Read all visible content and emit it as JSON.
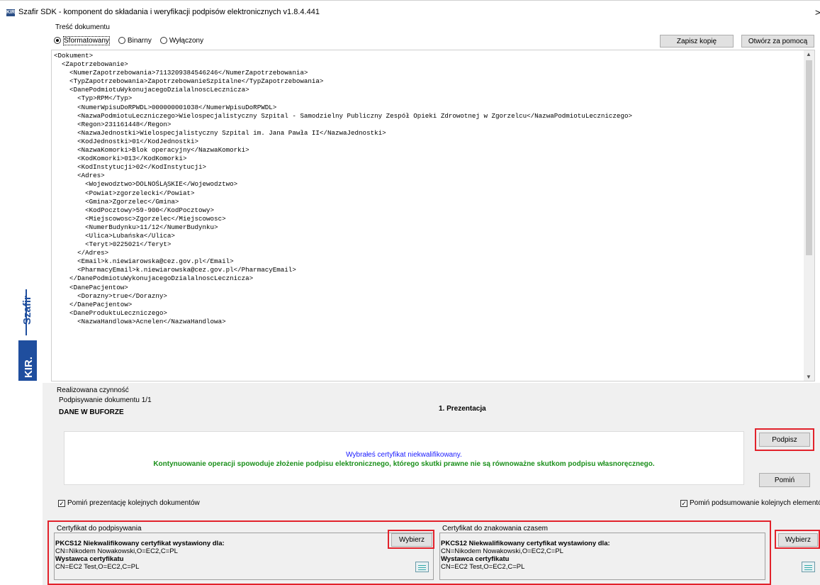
{
  "window": {
    "app_icon_text": "KIR",
    "title": "Szafir SDK - komponent do składania i weryfikacji podpisów elektronicznych v1.8.4.441",
    "close_glyph": ">"
  },
  "branding": {
    "szafir": "Szafir",
    "kir": "KIR."
  },
  "content_section": {
    "label": "Treść dokumentu",
    "radios": [
      {
        "label": "Sformatowany",
        "selected": true
      },
      {
        "label": "Binarny",
        "selected": false
      },
      {
        "label": "Wyłączony",
        "selected": false
      }
    ],
    "save_copy_button": "Zapisz kopię",
    "open_with_button": "Otwórz za pomocą"
  },
  "xml_lines": [
    "<Dokument>",
    "  <Zapotrzebowanie>",
    "    <NumerZapotrzebowania>711320938454624​6</NumerZapotrzebowania>",
    "    <TypZapotrzebowania>ZapotrzebowanieSzpitalne</TypZapotrzebowania>",
    "    <DanePodmiotuWykonujacegoDzialalnoscLecznicza>",
    "      <Typ>RPM</Typ>",
    "      <NumerWpisuDoRPWDL>000000001038</NumerWpisuDoRPWDL>",
    "      <NazwaPodmiotuLeczniczego>Wielospecjalistyczny Szpital - Samodzielny Publiczny Zespół Opieki Zdrowotnej w Zgorzelcu</NazwaPodmiotuLeczniczego>",
    "      <Regon>231161448</Regon>",
    "      <NazwaJednostki>Wielospecjalistyczny Szpital im. Jana Pawła II</NazwaJednostki>",
    "      <KodJednostki>01</KodJednostki>",
    "      <NazwaKomorki>Blok operacyjny</NazwaKomorki>",
    "      <KodKomorki>013</KodKomorki>",
    "      <KodInstytucji>02</KodInstytucji>",
    "      <Adres>",
    "        <Wojewodztwo>DOLNOŚLĄSKIE</Wojewodztwo>",
    "        <Powiat>zgorzelecki</Powiat>",
    "        <Gmina>Zgorzelec</Gmina>",
    "        <KodPocztowy>59-900</KodPocztowy>",
    "        <Miejscowosc>Zgorzelec</Miejscowosc>",
    "        <NumerBudynku>11/12</NumerBudynku>",
    "        <Ulica>Lubańska</Ulica>",
    "        <Teryt>0225021</Teryt>",
    "      </Adres>",
    "      <Email>k.niewiarowska@cez.gov.pl</Email>",
    "      <PharmacyEmail>k.niewiarowska@cez.gov.pl</PharmacyEmail>",
    "    </DanePodmiotuWykonujacegoDzialalnoscLecznicza>",
    "    <DanePacjentow>",
    "      <Dorazny>true</Dorazny>",
    "    </DanePacjentow>",
    "    <DaneProduktuLeczniczego>",
    "      <NazwaHandlowa>Acnelen</NazwaHandlowa>"
  ],
  "activity": {
    "label": "Realizowana czynność",
    "progress": "Podpisywanie dokumentu 1/1",
    "buffer": "DANE W BUFORZE",
    "step": "1. Prezentacja",
    "info_line": "Wybrałeś certyfikat niekwalifikowany.",
    "warning_line": "Kontynuowanie operacji spowoduje złożenie podpisu elektronicznego, którego skutki prawne nie są równoważne skutkom podpisu własnoręcznego.",
    "info_color": "#1a1aff",
    "warning_color": "#1a8f1a",
    "sign_button": "Podpisz",
    "skip_button": "Pomiń",
    "skip_presentation_checkbox": "Pomiń prezentację kolejnych dokumentów",
    "skip_summary_checkbox": "Pomiń podsumowanie kolejnych elementów"
  },
  "signing_cert": {
    "label": "Certyfikat do podpisywania",
    "heading": "PKCS12 Niekwalifikowany certyfikat wystawiony dla:",
    "subject": "CN=Nikodem Nowakowski,O=EC2,C=PL",
    "issuer_heading": "Wystawca certyfikatu",
    "issuer": "CN=EC2 Test,O=EC2,C=PL",
    "choose_button": "Wybierz"
  },
  "timestamp_cert": {
    "label": "Certyfikat do znakowania czasem",
    "heading": "PKCS12 Niekwalifikowany certyfikat wystawiony dla:",
    "subject": "CN=Nikodem Nowakowski,O=EC2,C=PL",
    "issuer_heading": "Wystawca certyfikatu",
    "issuer": "CN=EC2 Test,O=EC2,C=PL",
    "choose_button": "Wybierz"
  },
  "colors": {
    "accent_blue": "#1f4e9e",
    "highlight_red": "#e2222b"
  }
}
